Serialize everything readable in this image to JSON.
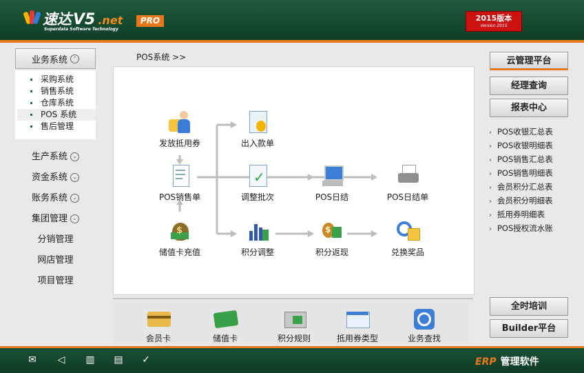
{
  "header": {
    "logo_cn": "速达",
    "logo_v5": "V5",
    "logo_net": ".net",
    "logo_sub": "Superdata Software Technology",
    "pro_badge": "PRO",
    "version_line1": "2015版本",
    "version_line2": "Version 2015"
  },
  "left": {
    "business_system": "业务系统",
    "submenu": [
      "采购系统",
      "销售系统",
      "仓库系统",
      "POS 系统",
      "售后管理"
    ],
    "active_submenu": "POS 系统",
    "systems": [
      {
        "label": "生产系统",
        "chevron": true
      },
      {
        "label": "资金系统",
        "chevron": true
      },
      {
        "label": "账务系统",
        "chevron": true
      },
      {
        "label": "集团管理",
        "chevron": true
      },
      {
        "label": "分销管理",
        "chevron": false
      },
      {
        "label": "网店管理",
        "chevron": false
      },
      {
        "label": "项目管理",
        "chevron": false
      }
    ]
  },
  "breadcrumb": "POS系统 >>",
  "flow": {
    "issue_coupon": "发放抵用券",
    "pos_sales_slip": "POS销售单",
    "stored_value_recharge": "储值卡充值",
    "cash_in_out": "出入款单",
    "adjust_batch": "调整批次",
    "points_adjust": "积分调整",
    "pos_daily_close": "POS日结",
    "points_cashback": "积分返现",
    "pos_daily_statement": "POS日结单",
    "redeem_prize": "兑换奖品"
  },
  "bottom_tools": [
    "会员卡",
    "储值卡",
    "积分规则",
    "抵用券类型",
    "业务查找"
  ],
  "right": {
    "cloud_platform": "云管理平台",
    "manager_query": "经理查询",
    "report_center": "报表中心",
    "reports": [
      "POS收银汇总表",
      "POS收银明细表",
      "POS销售汇总表",
      "POS销售明细表",
      "会员积分汇总表",
      "会员积分明细表",
      "抵用券明细表",
      "POS授权流水账"
    ],
    "training": "全时培训",
    "builder": "Builder平台"
  },
  "footer": {
    "erp": "ERP",
    "erp_label": "管理软件"
  },
  "colors": {
    "header_green": "#1a5236",
    "accent_orange": "#e8781a",
    "version_red": "#cc1111"
  }
}
